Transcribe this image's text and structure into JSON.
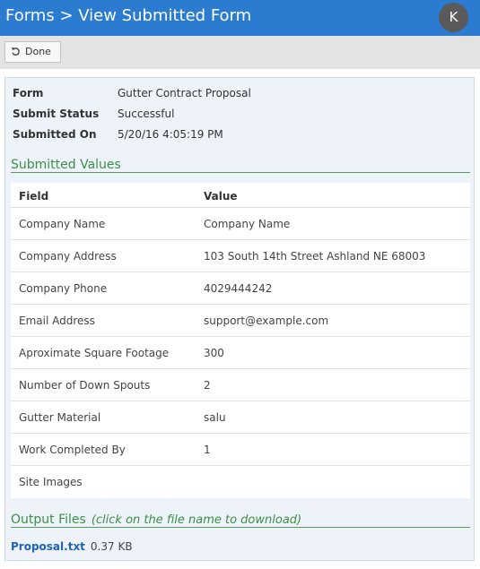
{
  "header": {
    "title": "Forms > View Submitted Form",
    "avatar_initial": "K"
  },
  "toolbar": {
    "done_label": "Done",
    "done_icon": "undo-arrow-icon"
  },
  "form_info": {
    "form_label": "Form",
    "form_value": "Gutter Contract Proposal",
    "status_label": "Submit Status",
    "status_value": "Successful",
    "submitted_label": "Submitted On",
    "submitted_value": "5/20/16 4:05:19 PM"
  },
  "submitted_values": {
    "title": "Submitted Values",
    "columns": [
      "Field",
      "Value"
    ],
    "rows": [
      {
        "field": "Company Name",
        "value": "Company Name"
      },
      {
        "field": "Company Address",
        "value": "103 South 14th Street Ashland NE 68003"
      },
      {
        "field": "Company Phone",
        "value": "4029444242"
      },
      {
        "field": "Email Address",
        "value": "support@example.com"
      },
      {
        "field": "Aproximate Square Footage",
        "value": "300"
      },
      {
        "field": "Number of Down Spouts",
        "value": "2"
      },
      {
        "field": "Gutter Material",
        "value": "salu"
      },
      {
        "field": "Work Completed By",
        "value": "1"
      },
      {
        "field": "Site Images",
        "value": ""
      }
    ]
  },
  "output_files": {
    "title": "Output Files",
    "hint": "(click on the file name to download)",
    "files": [
      {
        "name": "Proposal.txt",
        "size": "0.37 KB"
      }
    ]
  },
  "colors": {
    "header_bg": "#2b7bd1",
    "section_green": "#3c8f46",
    "link_blue": "#1f63b8"
  }
}
